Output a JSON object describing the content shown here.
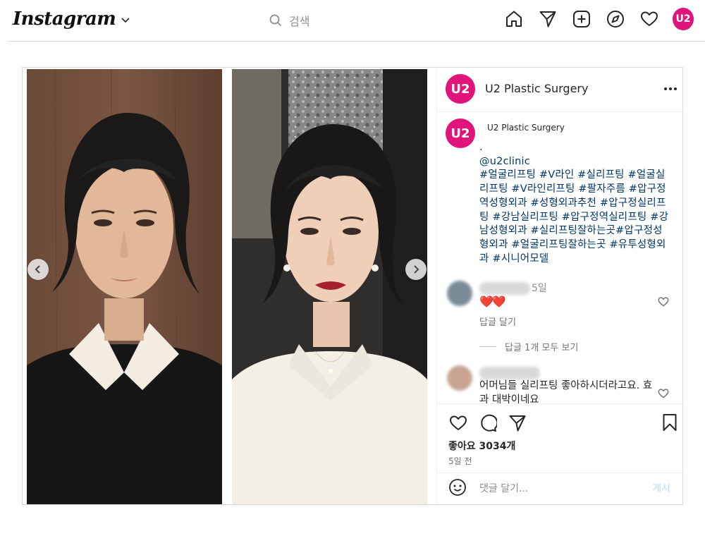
{
  "topbar": {
    "brand": "Instagram",
    "search_placeholder": "검색",
    "profile_badge": "U2"
  },
  "post": {
    "author": "U2 Plastic Surgery",
    "avatar_text": "U2",
    "caption": {
      "author": "U2 Plastic Surgery",
      "dot": ".",
      "mention": "@u2clinic",
      "hashtags": "#얼굴리프팅 #V라인 #실리프팅 #얼굴실리프팅 #V라인리프팅 #팔자주름 #압구정역성형외과 #성형외과추천 #압구정실리프팅 #강남실리프팅 #압구정역실리프팅 #강남성형외과 #실리프팅잘하는곳#압구정성형외과 #얼굴리프팅잘하는곳 #유투성형외과 #시니어모델"
    },
    "comments": [
      {
        "time": "5일",
        "hearts": "❤️❤️",
        "reply_label": "답글 달기",
        "view_replies": "답글 1개 모두 보기"
      },
      {
        "text": "어머님들 실리프팅 좋아하시더라고요. 효과 대박이네요"
      }
    ],
    "likes": "좋아요 3034개",
    "posted": "5일 전",
    "comment_placeholder": "댓글 달기...",
    "post_button": "게시"
  },
  "colors": {
    "brand_pink": "#e0147a",
    "link": "#00376b",
    "muted": "#737373"
  }
}
